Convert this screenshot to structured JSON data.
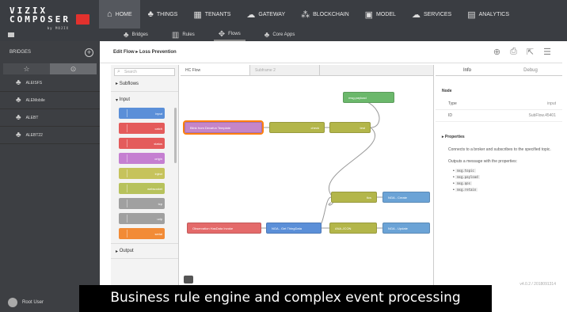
{
  "app": {
    "logo_line1": "VIZIX",
    "logo_line2": "COMPOSER",
    "logo_sub": "by MOJIX"
  },
  "nav": {
    "items": [
      {
        "label": "HOME",
        "icon": "home-icon",
        "glyph": "⌂"
      },
      {
        "label": "THINGS",
        "icon": "things-icon",
        "glyph": "♣"
      },
      {
        "label": "TENANTS",
        "icon": "tenants-icon",
        "glyph": "▦"
      },
      {
        "label": "GATEWAY",
        "icon": "cloud-icon",
        "glyph": "☁"
      },
      {
        "label": "BLOCKCHAIN",
        "icon": "blockchain-icon",
        "glyph": "⁂"
      },
      {
        "label": "MODEL",
        "icon": "model-icon",
        "glyph": "▣"
      },
      {
        "label": "SERVICES",
        "icon": "services-icon",
        "glyph": "☁"
      },
      {
        "label": "ANALYTICS",
        "icon": "analytics-icon",
        "glyph": "▤"
      }
    ],
    "subitems": [
      {
        "label": "Bridges",
        "icon": "bridges-icon",
        "glyph": "♣"
      },
      {
        "label": "Rules",
        "icon": "rules-icon",
        "glyph": "▥"
      },
      {
        "label": "Flows",
        "icon": "flows-icon",
        "glyph": "✥"
      },
      {
        "label": "Core Apps",
        "icon": "core-apps-icon",
        "glyph": "♣"
      }
    ]
  },
  "sidebar": {
    "title": "BRIDGES",
    "tabs": [
      "☆",
      "⊙"
    ],
    "items": [
      "ALEISFS",
      "ALEMobile",
      "ALEBT",
      "ALEBT22"
    ],
    "user": "Root User"
  },
  "editor": {
    "title": "Edit Flow ▸ Loss Prevention",
    "tools": [
      "⊕",
      "⎙",
      "⇱",
      "☰"
    ],
    "search_placeholder": "Search",
    "subflows_label": "Subflows",
    "input_label": "Input",
    "output_label": "Output",
    "palette_nodes": [
      {
        "label": "input",
        "color": "#5b8fd8"
      },
      {
        "label": "catch",
        "color": "#e45b5b"
      },
      {
        "label": "status",
        "color": "#e45b5b"
      },
      {
        "label": "origin",
        "color": "#c57fd1"
      },
      {
        "label": "inject",
        "color": "#c6c35c"
      },
      {
        "label": "websocket",
        "color": "#b7c25c"
      },
      {
        "label": "tcp",
        "color": "#a0a0a0"
      },
      {
        "label": "udp",
        "color": "#a0a0a0"
      },
      {
        "label": "serial",
        "color": "#f28b36"
      }
    ],
    "tabs": [
      "HC Flow",
      "Subframe 2"
    ],
    "flow_nodes": [
      {
        "id": "n1",
        "label": "Blink from Devafun Template",
        "color": "#c585c8"
      },
      {
        "id": "n2",
        "label": "check",
        "color": "#b3b64a"
      },
      {
        "id": "n3",
        "label": "test",
        "color": "#b3b64a"
      },
      {
        "id": "n4",
        "label": "msg.payload",
        "color": "#6bb86b"
      },
      {
        "id": "n5",
        "label": "tics",
        "color": "#b3b64a"
      },
      {
        "id": "n6",
        "label": "NGA - Create",
        "color": "#6ba3d6"
      },
      {
        "id": "n7",
        "label": "Observation HasData Invoke",
        "color": "#e46a6a"
      },
      {
        "id": "n8",
        "label": "NGA - Get ThingData",
        "color": "#5b8fd8"
      },
      {
        "id": "n9",
        "label": "ANA-JCON",
        "color": "#b3b64a"
      },
      {
        "id": "n10",
        "label": "NGA - Update",
        "color": "#6ba3d6"
      }
    ]
  },
  "info_panel": {
    "tabs": [
      "Info",
      "Debug"
    ],
    "node_heading": "Node",
    "rows": [
      {
        "k": "Type",
        "v": "input"
      },
      {
        "k": "ID",
        "v": "SubFlow.45401"
      }
    ],
    "properties_heading": "Properties",
    "desc1": "Connects to a broker and subscribes to the specified topic.",
    "desc2": "Outputs a message with the properties:",
    "props": [
      "msg.topic",
      "msg.payload",
      "msg.qos",
      "msg.retain"
    ],
    "version": "v4.0.2 / 2018091314"
  },
  "caption": "Business rule engine and complex event processing"
}
